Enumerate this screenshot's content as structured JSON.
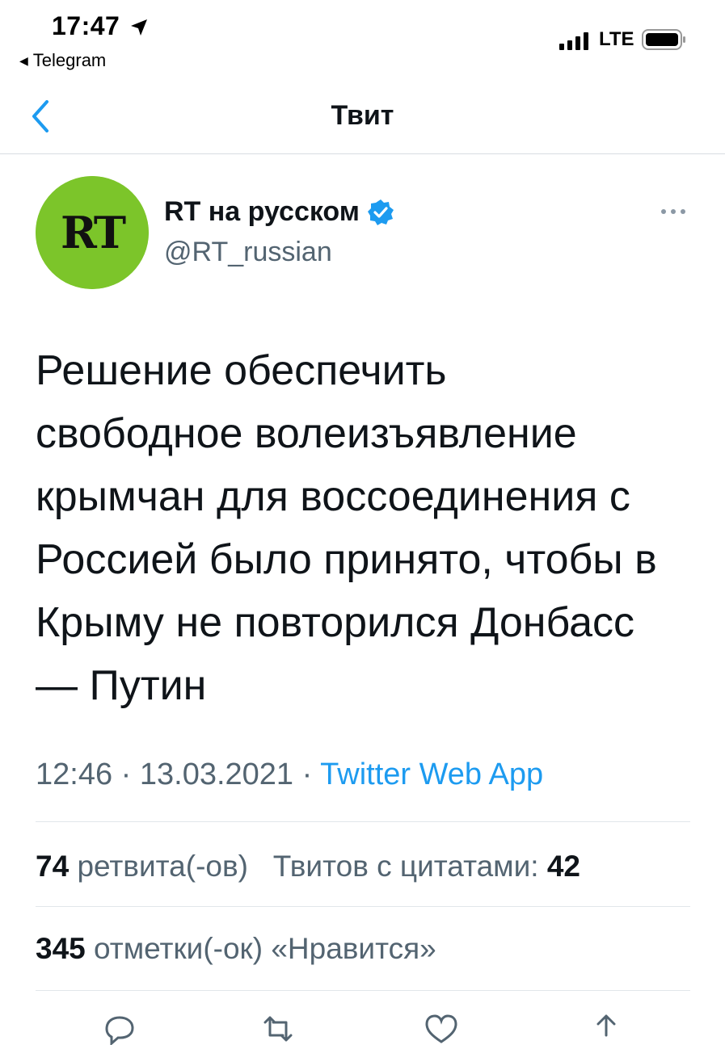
{
  "status_bar": {
    "time": "17:47",
    "back_app": "Telegram",
    "network": "LTE"
  },
  "header": {
    "title": "Твит"
  },
  "author": {
    "name": "RT на русском",
    "handle": "@RT_russian",
    "avatar_text": "RT",
    "avatar_color": "#7cc52a",
    "verified": true
  },
  "tweet": {
    "lines": [
      "Решение обеспечить",
      "свободное волеизъявление",
      "крымчан для воссоединения с",
      "Россией было принято, чтобы в",
      "Крыму не повторился Донбасс",
      "— Путин"
    ],
    "time": "12:46",
    "date": "13.03.2021",
    "separator": "·",
    "source": "Twitter Web App"
  },
  "stats": {
    "retweets_count": "74",
    "retweets_label": "ретвита(-ов)",
    "quotes_label": "Твитов с цитатами:",
    "quotes_count": "42",
    "likes_count": "345",
    "likes_label": "отметки(-ок) «Нравится»"
  },
  "actions": {
    "icons": [
      "reply-icon",
      "retweet-icon",
      "like-icon",
      "share-icon"
    ]
  },
  "colors": {
    "accent": "#1d9bf0",
    "text_primary": "#0f1419",
    "text_secondary": "#536471",
    "divider": "#d8dde1"
  }
}
